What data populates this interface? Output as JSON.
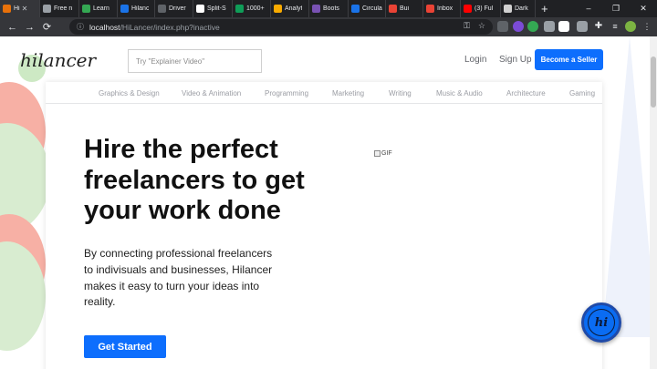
{
  "browser": {
    "tabs": [
      {
        "label": "Hi",
        "color": "#e8710a",
        "active": true
      },
      {
        "label": "Free n",
        "color": "#9aa0a6"
      },
      {
        "label": "Learn",
        "color": "#34a853"
      },
      {
        "label": "Hilanc",
        "color": "#1a73e8"
      },
      {
        "label": "Driver",
        "color": "#5f6368"
      },
      {
        "label": "Split-S",
        "color": "#ffffff"
      },
      {
        "label": "1000+",
        "color": "#0f9d58"
      },
      {
        "label": "Analyt",
        "color": "#f9ab00"
      },
      {
        "label": "Boots",
        "color": "#7952b3"
      },
      {
        "label": "Circula",
        "color": "#1a73e8"
      },
      {
        "label": "Bui",
        "color": "#ea4335"
      },
      {
        "label": "Inbox",
        "color": "#ea4335"
      },
      {
        "label": "(3) Ful",
        "color": "#ff0000"
      },
      {
        "label": "Dark",
        "color": "#d1d1d1"
      }
    ],
    "new_tab_label": "+",
    "window_controls": {
      "minimize": "–",
      "maximize": "❐",
      "close": "✕"
    },
    "url_host": "localhost",
    "url_path": "/HiLancer/index.php?inactive",
    "nav": {
      "back": "←",
      "forward": "→",
      "reload": "⟳"
    }
  },
  "site": {
    "logo": "hilancer",
    "search_placeholder": "Try \"Explainer Video\"",
    "login_label": "Login",
    "signup_label": "Sign Up",
    "seller_button_label": "Become a Seller",
    "brand_color": "#0d6efd",
    "categories": [
      "Graphics & Design",
      "Video & Animation",
      "Programming",
      "Marketing",
      "Writing",
      "Music & Audio",
      "Architecture",
      "Gaming"
    ],
    "hero": {
      "title_lines": [
        "Hire the perfect",
        "freelancers to get",
        "your work done"
      ],
      "subtitle_lines": [
        "By connecting professional freelancers",
        "to indivisuals and businesses, Hilancer",
        "makes it easy to turn your ideas into",
        "reality."
      ],
      "cta_label": "Get Started",
      "gif_alt": "GIF"
    },
    "chat_bubble_label": "hi"
  }
}
